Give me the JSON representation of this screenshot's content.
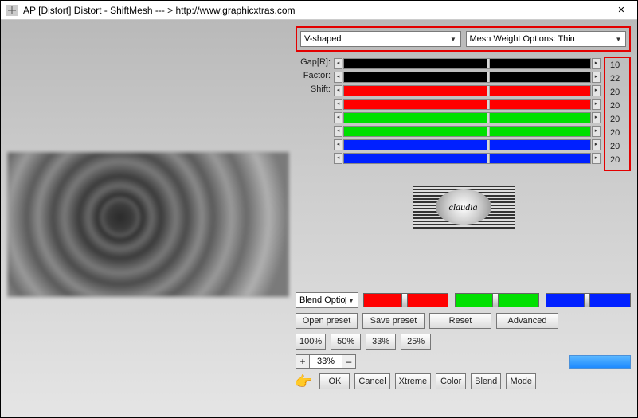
{
  "window": {
    "title": "AP [Distort]  Distort - ShiftMesh    --- > http://www.graphicxtras.com",
    "close_char": "✕"
  },
  "dropdowns": {
    "shape": {
      "value": "V-shaped"
    },
    "mesh": {
      "value": "Mesh Weight Options: Thin"
    }
  },
  "sliders": [
    {
      "label": "Gap[R]:",
      "value": "10",
      "color": "#000000",
      "pos": 58
    },
    {
      "label": "Factor:",
      "value": "22",
      "color": "#000000",
      "pos": 58
    },
    {
      "label": "Shift:",
      "value": "20",
      "color": "#ff0000",
      "pos": 58
    },
    {
      "label": "",
      "value": "20",
      "color": "#ff0000",
      "pos": 58
    },
    {
      "label": "",
      "value": "20",
      "color": "#00e000",
      "pos": 58
    },
    {
      "label": "",
      "value": "20",
      "color": "#00e000",
      "pos": 58
    },
    {
      "label": "",
      "value": "20",
      "color": "#0020ff",
      "pos": 58
    },
    {
      "label": "",
      "value": "20",
      "color": "#0020ff",
      "pos": 58
    }
  ],
  "logo": {
    "text": "claudia"
  },
  "blend_options": {
    "label": "Blend Optio"
  },
  "blend_color_sliders": [
    {
      "color": "#ff0000",
      "pos": 48
    },
    {
      "color": "#00e000",
      "pos": 48
    },
    {
      "color": "#0020ff",
      "pos": 48
    }
  ],
  "buttons": {
    "open_preset": "Open preset",
    "save_preset": "Save preset",
    "reset": "Reset",
    "advanced": "Advanced"
  },
  "percent_buttons": [
    "100%",
    "50%",
    "33%",
    "25%"
  ],
  "zoom": {
    "plus": "+",
    "value": "33%",
    "minus": "–"
  },
  "action_buttons": [
    "OK",
    "Cancel",
    "Xtreme",
    "Color",
    "Blend",
    "Mode"
  ]
}
